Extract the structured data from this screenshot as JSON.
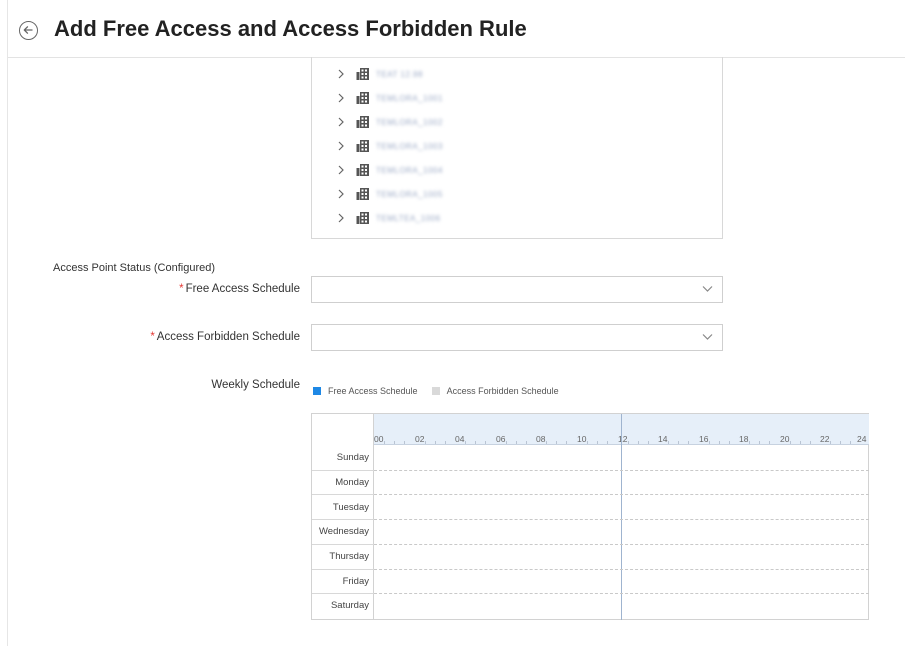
{
  "header": {
    "title": "Add Free Access and Access Forbidden Rule",
    "back_icon": "back-arrow-circle-icon"
  },
  "tree": {
    "items": [
      {
        "label": "TEAT 12.98"
      },
      {
        "label": "TEMLORA_1001"
      },
      {
        "label": "TEMLORA_1002"
      },
      {
        "label": "TEMLORA_1003"
      },
      {
        "label": "TEMLORA_1004"
      },
      {
        "label": "TEMLORA_1005"
      },
      {
        "label": "TEMLTEA_1006"
      }
    ]
  },
  "section": {
    "status_label": "Access Point Status (Configured)"
  },
  "form": {
    "free_access": {
      "label": "Free Access Schedule",
      "required_mark": "*",
      "value": ""
    },
    "forbidden": {
      "label": "Access Forbidden Schedule",
      "required_mark": "*",
      "value": ""
    },
    "weekly_label": "Weekly Schedule"
  },
  "legend": {
    "free_access": {
      "label": "Free Access Schedule",
      "color": "#1e88e5"
    },
    "forbidden": {
      "label": "Access Forbidden Schedule",
      "color": "#d9d9d9"
    }
  },
  "schedule": {
    "hours": [
      "00",
      "02",
      "04",
      "06",
      "08",
      "10",
      "12",
      "14",
      "16",
      "18",
      "20",
      "22",
      "24"
    ],
    "days": [
      "Sunday",
      "Monday",
      "Tuesday",
      "Wednesday",
      "Thursday",
      "Friday",
      "Saturday"
    ]
  },
  "colors": {
    "required": "#e53935",
    "header_bg": "#e6eff9"
  }
}
